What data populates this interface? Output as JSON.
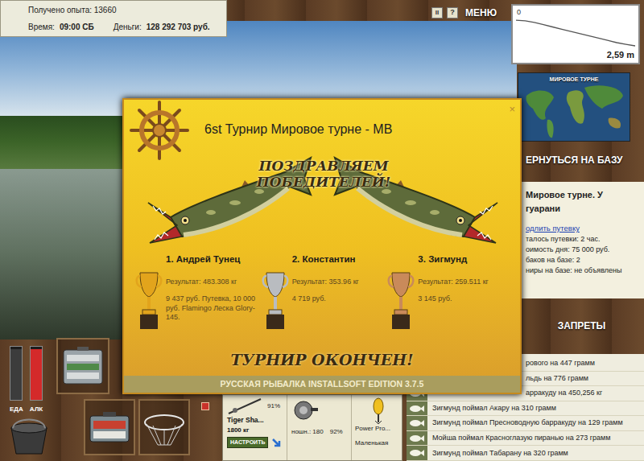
{
  "hud": {
    "experience": "Получено опыта: 13660",
    "time_label": "Время:",
    "time": "09:00 СБ",
    "money_label": "Деньги:",
    "money": "128 292 703 руб."
  },
  "toolbar": {
    "pause": "II",
    "help": "?",
    "menu": "МЕНЮ"
  },
  "depth": {
    "top_tick": "0",
    "reading": "2,59 m",
    "profile": [
      0.3,
      0.35,
      0.5,
      0.7,
      0.9,
      1.1,
      1.3,
      1.5,
      1.7,
      1.9,
      2.1,
      2.3,
      2.45,
      2.59
    ]
  },
  "map": {
    "caption": "МИРОВОЕ ТУРНЕ"
  },
  "return_button": "ЕРНУТЬСЯ НА БАЗУ",
  "location": {
    "title": "Мировое турне. У",
    "subtitle": "гуарани",
    "extend_link": "одлить путевку",
    "lines": [
      "талось путевки: 2 час.",
      "оимость дня: 75 000 руб.",
      "баков на базе: 2",
      "ниры на базе: не объявлены"
    ]
  },
  "bans_button": "ЗАПРЕТЫ",
  "catch_log": [
    {
      "text": "рового на 447 грамм",
      "covered": true
    },
    {
      "text": "льдь на 776 грамм",
      "covered": true
    },
    {
      "text": "арракуду на 450,256 кг",
      "covered": true
    },
    {
      "text": "Зигмунд поймал Акару на 310 грамм",
      "covered": false
    },
    {
      "text": "Зигмунд поймал Пресноводную барракуду на 129 грамм",
      "covered": false
    },
    {
      "text": "Мойша поймал Красноглазую пиранью на 273 грамм",
      "covered": false
    },
    {
      "text": "Зигмунд поймал Табарану на 320 грамм",
      "covered": false
    }
  ],
  "needs": [
    {
      "label": "ЕДА",
      "level": 0.95,
      "color": "#3c3c3c"
    },
    {
      "label": "АЛК",
      "level": 0.95,
      "color": "#d42a2a"
    }
  ],
  "rod": {
    "name": "Tiger Sha...",
    "strength": "1800 кг",
    "wear": "91%",
    "setup_button": "НАСТРОИТЬ"
  },
  "reel": {
    "label": "ношн.: 180",
    "wear": "92%"
  },
  "line": {
    "name": "Power Pro..."
  },
  "lure": {
    "name": "Маленькая"
  },
  "dialog": {
    "title": "6st Турнир Мировое турне - МВ",
    "close": "×",
    "banner": "ПОЗДРАВЛЯЕМ ПОБЕДИТЕЛЕЙ!",
    "winners": [
      {
        "place": "1. Андрей Тунец",
        "result": "Результат: 483.308 кг",
        "prize": "9 437 руб. Путевка, 10 000 руб. Flamingo Леска Glory-145.",
        "color": "#e2a41c"
      },
      {
        "place": "2. Константин",
        "result": "Результат: 353.96 кг",
        "prize": "4 719 руб.",
        "color": "#b9bcc0"
      },
      {
        "place": "3. Зигмунд",
        "result": "Результат: 259.511 кг",
        "prize": "3 145 руб.",
        "color": "#c98a5a"
      }
    ],
    "finished": "ТУРНИР ОКОНЧЕН!",
    "edition": "РУССКАЯ РЫБАЛКА INSTALLSOFT EDITION 3.7.5"
  }
}
